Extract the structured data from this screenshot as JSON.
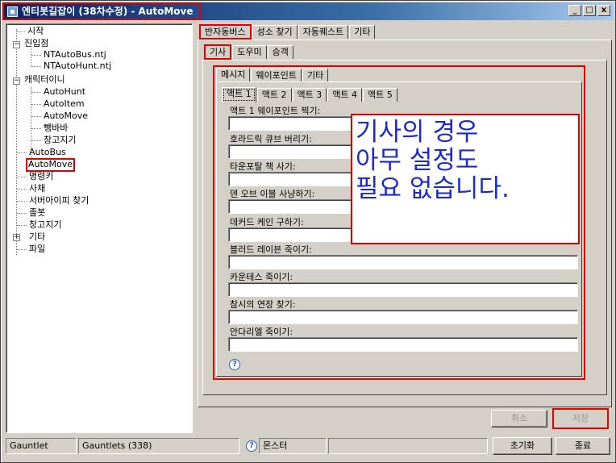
{
  "window": {
    "title": "엔티봇길잡이 (38차수정) - AutoMove",
    "controls": [
      "_",
      "□",
      "x"
    ]
  },
  "tree": {
    "items": [
      {
        "label": "시작"
      },
      {
        "label": "진입점"
      },
      {
        "label": "NTAutoBus.ntj"
      },
      {
        "label": "NTAutoHunt.ntj"
      },
      {
        "label": "캐릭터이니"
      },
      {
        "label": "AutoHunt"
      },
      {
        "label": "AutoItem"
      },
      {
        "label": "AutoMove"
      },
      {
        "label": "뺑바바"
      },
      {
        "label": "창고지기"
      },
      {
        "label": "AutoBus"
      },
      {
        "label": "AutoMove"
      },
      {
        "label": "명령키"
      },
      {
        "label": "사채"
      },
      {
        "label": "서버아이피 찾기"
      },
      {
        "label": "졸봇"
      },
      {
        "label": "창고지기"
      },
      {
        "label": "기타"
      },
      {
        "label": "파일"
      }
    ]
  },
  "tabs_main": [
    {
      "label": "반자동버스"
    },
    {
      "label": "성소 찾기"
    },
    {
      "label": "자동퀘스트"
    },
    {
      "label": "기타"
    }
  ],
  "tabs_class": [
    {
      "label": "기사"
    },
    {
      "label": "도우미"
    },
    {
      "label": "승객"
    }
  ],
  "tabs_sub": [
    {
      "label": "메시지"
    },
    {
      "label": "웨이포인트"
    },
    {
      "label": "기타"
    }
  ],
  "tabs_act": [
    {
      "label": "액트 1"
    },
    {
      "label": "액트 2"
    },
    {
      "label": "액트 3"
    },
    {
      "label": "액트 4"
    },
    {
      "label": "액트 5"
    }
  ],
  "fields": [
    {
      "label": "액트 1 웨이포인트 찍기:",
      "value": ""
    },
    {
      "label": "호라드릭 큐브 버리기:",
      "value": ""
    },
    {
      "label": "타운포탈 책 사기:",
      "value": ""
    },
    {
      "label": "덴 오브 이블 사냥하기:",
      "value": ""
    },
    {
      "label": "데커드 케인 구하기:",
      "value": ""
    },
    {
      "label": "블러드 레이븐 죽이기:",
      "value": ""
    },
    {
      "label": "카운테스 죽이기:",
      "value": ""
    },
    {
      "label": "참시의 연장 찾기:",
      "value": ""
    },
    {
      "label": "안다리엘 죽이기:",
      "value": ""
    }
  ],
  "overlay": {
    "lines": [
      "기사의 경우",
      "아무 설정도",
      "필요 없습니다."
    ]
  },
  "buttons": {
    "cancel": "취소",
    "save": "저장",
    "reset": "초기화",
    "exit": "종료"
  },
  "status": {
    "left": "Gauntlet",
    "middle": "Gauntlets (338)",
    "monster": "몬스터",
    "blank": ""
  },
  "colors": {
    "highlight": "#e00000",
    "overlay_text": "#1c2ad0",
    "titlebar": "#0a246a"
  }
}
